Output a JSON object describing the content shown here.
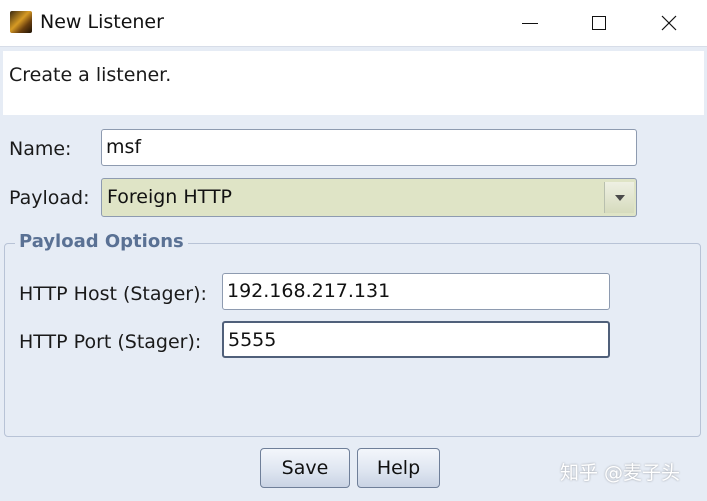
{
  "window": {
    "title": "New Listener",
    "app_icon": "cobalt-strike-app-icon",
    "controls": [
      "minimize-icon",
      "maximize-icon",
      "close-icon"
    ]
  },
  "dialog": {
    "description": "Create a listener.",
    "name_label": "Name:",
    "name_value": "msf",
    "payload_label": "Payload:",
    "payload_value": "Foreign HTTP",
    "payload_options": {
      "title": "Payload Options",
      "host_label": "HTTP Host (Stager):",
      "host_value": "192.168.217.131",
      "port_label": "HTTP Port (Stager):",
      "port_value": "5555"
    },
    "buttons": {
      "save": "Save",
      "help": "Help"
    }
  },
  "watermark": "知乎 @麦子头",
  "colors": {
    "dialog_bg": "#e6ecf5",
    "combo_bg": "#dfe4c6",
    "group_title": "#5a7194"
  }
}
